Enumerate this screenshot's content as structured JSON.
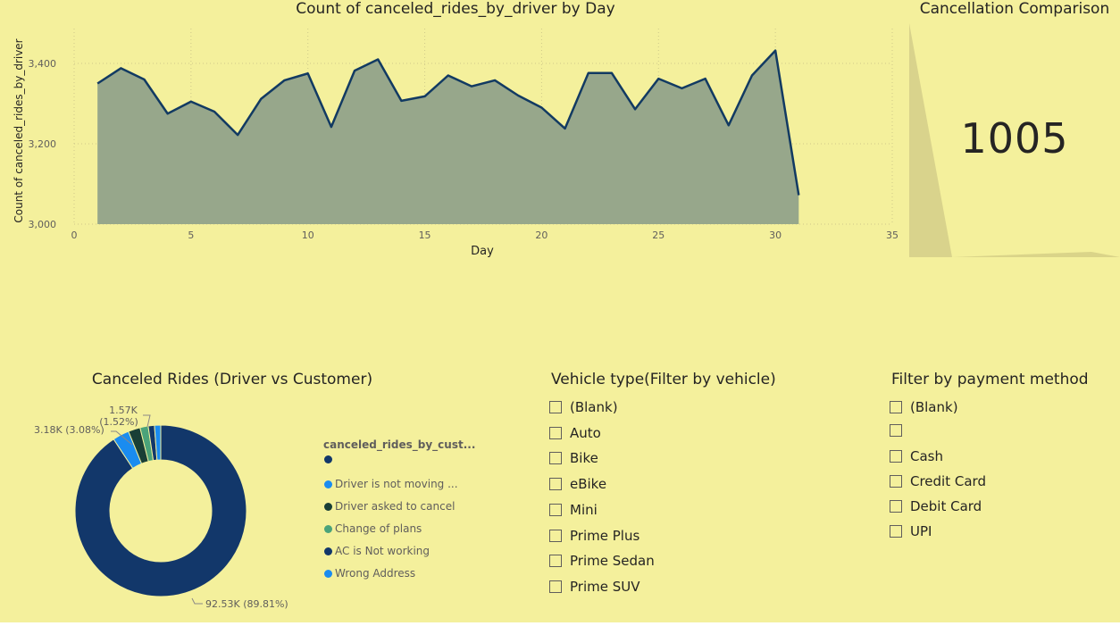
{
  "line_visual": {
    "title": "Count of canceled_rides_by_driver by Day"
  },
  "card": {
    "title": "Cancellation Comparison",
    "value": "1005"
  },
  "donut_visual": {
    "title": "Canceled Rides (Driver vs Customer)",
    "legend_title": "canceled_rides_by_cust...",
    "legend_items": [
      {
        "label": "",
        "color": "#12376a"
      },
      {
        "label": "Driver is not moving ...",
        "color": "#1a8cf0"
      },
      {
        "label": "Driver asked to cancel",
        "color": "#193f36"
      },
      {
        "label": "Change of plans",
        "color": "#4aa37a"
      },
      {
        "label": "AC is Not working",
        "color": "#12376a"
      },
      {
        "label": "Wrong Address",
        "color": "#1a8cf0"
      }
    ]
  },
  "vehicle_slicer": {
    "title": "Vehicle type(Filter by vehicle)",
    "items": [
      "(Blank)",
      "Auto",
      "Bike",
      "eBike",
      "Mini",
      "Prime Plus",
      "Prime Sedan",
      "Prime SUV"
    ]
  },
  "payment_slicer": {
    "title": "Filter by payment method",
    "items": [
      "(Blank)",
      "",
      "Cash",
      "Credit Card",
      "Debit Card",
      "UPI"
    ]
  },
  "chart_data": [
    {
      "type": "area",
      "title": "Count of canceled_rides_by_driver by Day",
      "xlabel": "Day",
      "ylabel": "Count of canceled_rides_by_driver",
      "xlim": [
        0,
        35
      ],
      "ylim": [
        3000,
        3500
      ],
      "x_ticks": [
        "0",
        "5",
        "10",
        "15",
        "20",
        "25",
        "30",
        "35"
      ],
      "y_ticks": [
        "3,000",
        "3,200",
        "3,400"
      ],
      "grid": true,
      "colors": {
        "line": "#123a62",
        "fill": "#97a78b"
      },
      "x": [
        1,
        2,
        3,
        4,
        5,
        6,
        7,
        8,
        9,
        10,
        11,
        12,
        13,
        14,
        15,
        16,
        17,
        18,
        19,
        20,
        21,
        22,
        23,
        24,
        25,
        26,
        27,
        28,
        29,
        30,
        31
      ],
      "values": [
        3350,
        3388,
        3360,
        3275,
        3305,
        3280,
        3222,
        3312,
        3358,
        3375,
        3242,
        3382,
        3410,
        3307,
        3318,
        3370,
        3343,
        3358,
        3320,
        3290,
        3238,
        3376,
        3376,
        3286,
        3362,
        3338,
        3362,
        3246,
        3370,
        3432,
        3072
      ]
    },
    {
      "type": "pie",
      "title": "Canceled Rides (Driver vs Customer)",
      "donut": true,
      "data_labels": [
        "92.53K (89.81%)",
        "3.18K (3.08%)",
        "1.57K (1.52%)"
      ],
      "slices": [
        {
          "label": "",
          "value": 92530,
          "color": "#12376a"
        },
        {
          "label": "Driver is not moving ...",
          "value": 3180,
          "color": "#1a8cf0"
        },
        {
          "label": "Driver asked to cancel",
          "value": 2300,
          "color": "#193f36"
        },
        {
          "label": "Change of plans",
          "value": 1570,
          "color": "#4aa37a"
        },
        {
          "label": "AC is Not working",
          "value": 1200,
          "color": "#12376a"
        },
        {
          "label": "Wrong Address",
          "value": 1200,
          "color": "#1a8cf0"
        }
      ]
    }
  ]
}
